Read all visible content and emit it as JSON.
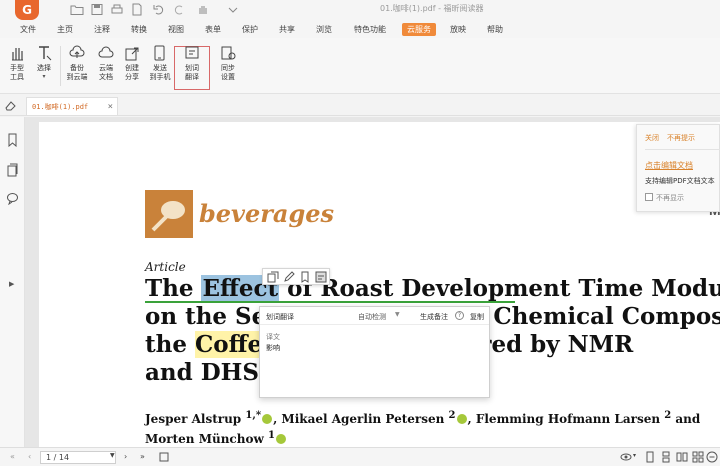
{
  "window": {
    "title": "01.咖啡(1).pdf - 福昕阅读器",
    "logo": "G"
  },
  "quick_access": [
    "folder-icon",
    "save-icon",
    "print-icon",
    "document-icon",
    "undo-icon",
    "redo-icon",
    "hand-icon",
    "dropdown-icon"
  ],
  "menu": {
    "file": "文件",
    "home": "主页",
    "comment": "注释",
    "convert": "转换",
    "view": "视图",
    "form": "表单",
    "protect": "保护",
    "share": "共享",
    "browse": "浏览",
    "features": "特色功能",
    "cloud": "云服务",
    "screencast": "放映",
    "help": "帮助"
  },
  "ribbon": {
    "hand_tool": "手型\n工具",
    "select": "选择",
    "backup_cloud": "备份\n到云端",
    "cloud_docs": "云端\n文档",
    "create_share": "创建\n分享",
    "send_phone": "发送\n到手机",
    "word_translate": "划词\n翻译",
    "sync_settings": "同步\n设置"
  },
  "tab": {
    "filename": "01.咖啡(1).pdf",
    "close": "×"
  },
  "document": {
    "journal": "beverages",
    "article_type": "Article",
    "title_l1_pre": "The ",
    "title_l1_sel": "Effect",
    "title_l1_post": " of Roast Development Time Modulation",
    "title_l2": "on the Sensory Profile and Chemical Composition",
    "title_l3_pre": "the ",
    "title_l3_sel": "Coffee",
    "title_l3_post": " Brew as Measured by NMR",
    "title_l4": "and DHS-GC–MS",
    "authors_l1_a": "Jesper Alstrup ",
    "authors_l1_a_sup": "1,*",
    "authors_l1_b": ", Mikael Agerlin Petersen ",
    "authors_l1_b_sup": "2",
    "authors_l1_c": ", Flemming Hofmann Larsen ",
    "authors_l1_c_sup": "2",
    "authors_l1_d": " and",
    "authors_l2": "Morten Münchow ",
    "authors_l2_sup": "1",
    "right_cut": "M"
  },
  "translate_popup": {
    "title": "划词翻译",
    "lang": "自动检测",
    "note": "生成备注",
    "help": "?",
    "copy": "复制",
    "label": "译文",
    "result": "影响"
  },
  "notification": {
    "close": "关闭",
    "no_more": "不再提示",
    "link": "点击编辑文档",
    "desc": "支持编辑PDF文档文本",
    "checkbox_label": "不再显示"
  },
  "status": {
    "page": "1 / 14",
    "zoom_placeholder": ""
  }
}
